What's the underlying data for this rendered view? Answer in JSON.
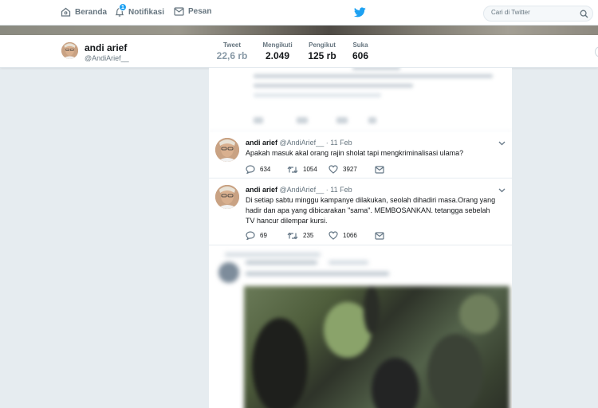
{
  "nav": {
    "home": "Beranda",
    "notifications": "Notifikasi",
    "notifications_badge": "1",
    "messages": "Pesan",
    "search_placeholder": "Cari di Twitter"
  },
  "profile": {
    "name": "andi arief",
    "handle": "@AndiArief__",
    "stats": [
      {
        "label": "Tweet",
        "value": "22,6 rb"
      },
      {
        "label": "Mengikuti",
        "value": "2.049"
      },
      {
        "label": "Pengikut",
        "value": "125 rb"
      },
      {
        "label": "Suka",
        "value": "606"
      }
    ]
  },
  "tweets": [
    {
      "name": "andi arief",
      "handle": "@AndiArief__",
      "dot": "·",
      "date": "11 Feb",
      "text": "Apakah masuk akal orang rajin sholat tapi mengkriminalisasi ulama?",
      "replies": "634",
      "retweets": "1054",
      "likes": "3927"
    },
    {
      "name": "andi arief",
      "handle": "@AndiArief__",
      "dot": "·",
      "date": "11 Feb",
      "text": "Di setiap sabtu minggu kampanye dilakukan, seolah dihadiri masa.Orang yang hadir dan apa yang dibicarakan \"sama\". MEMBOSANKAN. tetangga sebelah TV hancur dilempar kursi.",
      "replies": "69",
      "retweets": "235",
      "likes": "1066"
    }
  ],
  "colors": {
    "accent": "#1da1f2",
    "background": "#e6ecf0",
    "muted": "#66757f",
    "retweet": "#17bf63"
  }
}
